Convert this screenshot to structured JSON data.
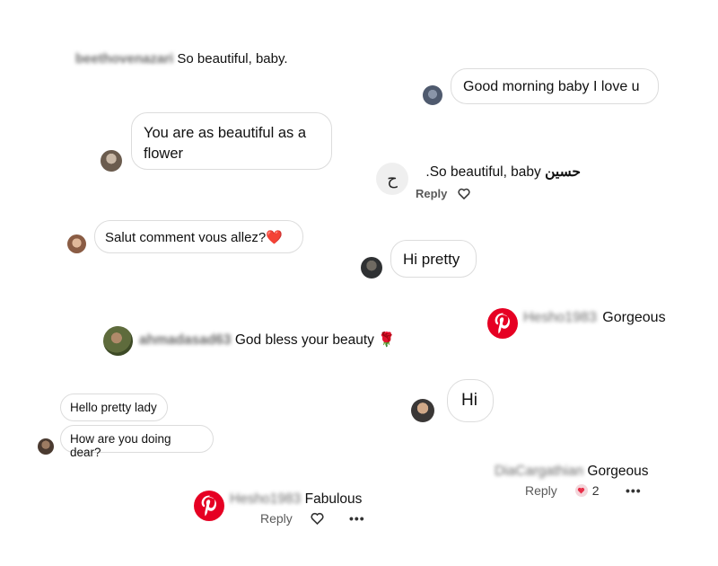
{
  "comments": {
    "c1": {
      "username": "beethovenazari",
      "text": "So beautiful, baby."
    },
    "c2": {
      "text": "Good morning baby I love u"
    },
    "c3": {
      "text": "You are as beautiful as a flower"
    },
    "c4": {
      "avatar_letter": "ح",
      "username": "حسين",
      "text": "So beautiful, baby.",
      "reply": "Reply"
    },
    "c5": {
      "text": "Salut comment vous allez?❤️"
    },
    "c6": {
      "text": "Hi pretty"
    },
    "c7": {
      "username": "Hesho1983",
      "text": "Gorgeous"
    },
    "c8": {
      "username": "ahmadasad63",
      "text": "God bless your beauty 🌹"
    },
    "c9": {
      "line1": "Hello pretty lady",
      "line2": "How are you doing dear?"
    },
    "c10": {
      "text": "Hi"
    },
    "c11": {
      "username": "DiaCargathian",
      "text": "Gorgeous",
      "reply": "Reply",
      "likes": "2"
    },
    "c12": {
      "username": "Hesho1983",
      "text": "Fabulous",
      "reply": "Reply"
    }
  },
  "colors": {
    "pinterest_red": "#e60023",
    "heart_red": "#e8304a",
    "bubble_border": "#dcdcdc"
  },
  "icons": [
    "heart-outline-icon",
    "heart-filled-icon",
    "more-dots-icon",
    "pinterest-logo-icon"
  ]
}
